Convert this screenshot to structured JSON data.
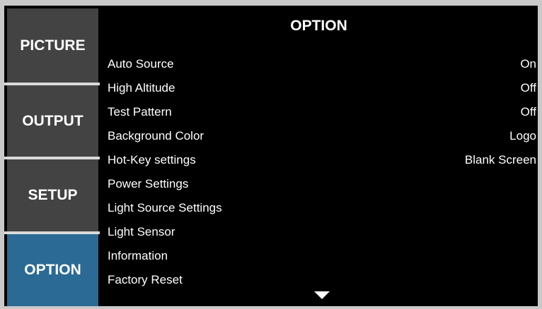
{
  "sidebar": {
    "tabs": [
      {
        "label": "PICTURE",
        "active": false
      },
      {
        "label": "OUTPUT",
        "active": false
      },
      {
        "label": "SETUP",
        "active": false
      },
      {
        "label": "OPTION",
        "active": true
      }
    ]
  },
  "panel": {
    "title": "OPTION",
    "items": [
      {
        "label": "Auto Source",
        "value": "On"
      },
      {
        "label": "High Altitude",
        "value": "Off"
      },
      {
        "label": "Test Pattern",
        "value": "Off"
      },
      {
        "label": "Background Color",
        "value": "Logo"
      },
      {
        "label": "Hot-Key settings",
        "value": "Blank Screen"
      },
      {
        "label": "Power Settings",
        "value": ""
      },
      {
        "label": "Light Source Settings",
        "value": ""
      },
      {
        "label": "Light Sensor",
        "value": ""
      },
      {
        "label": "Information",
        "value": ""
      },
      {
        "label": "Factory Reset",
        "value": ""
      }
    ],
    "more_icon": "chevron-down-icon"
  },
  "colors": {
    "active_tab": "#2b6a94",
    "inactive_tab": "#434343",
    "background": "#000000",
    "text": "#ffffff"
  }
}
